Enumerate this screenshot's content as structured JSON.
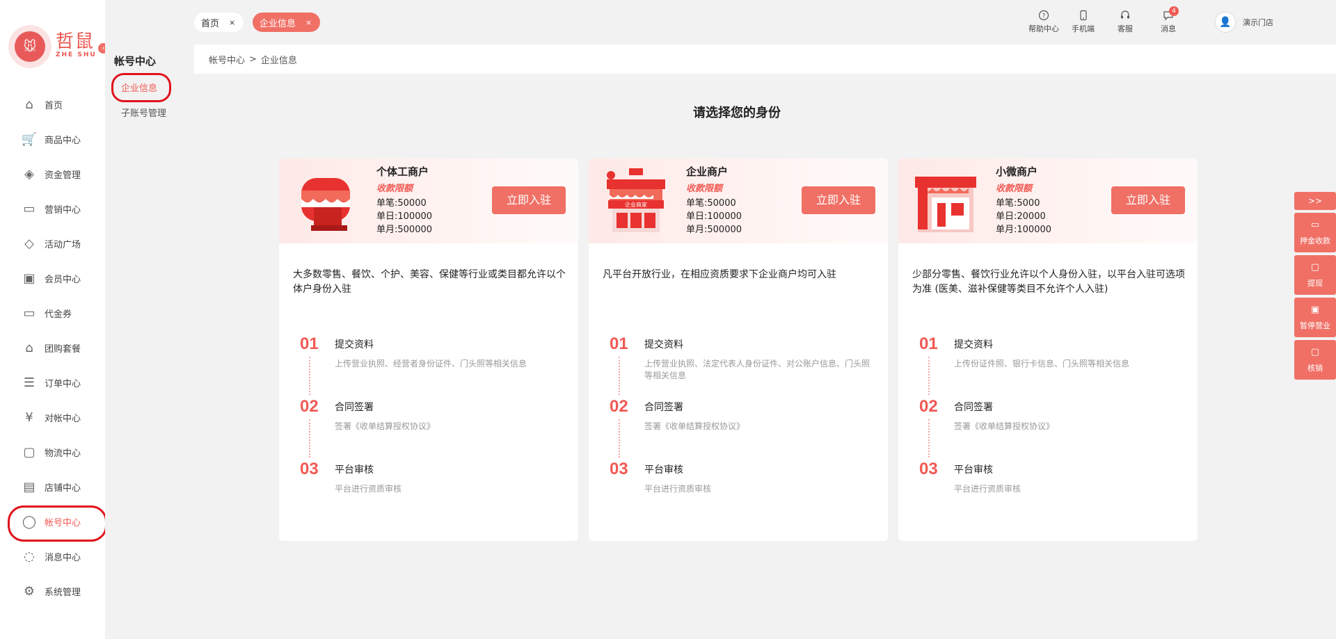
{
  "logo": {
    "cn": "哲鼠",
    "en": "ZHE SHU"
  },
  "collapse_label": "‹",
  "nav": [
    {
      "label": "首页",
      "icon": "home-icon",
      "glyph": "⌂"
    },
    {
      "label": "商品中心",
      "icon": "cart-icon",
      "glyph": "🛒"
    },
    {
      "label": "资金管理",
      "icon": "layers-icon",
      "glyph": "◈"
    },
    {
      "label": "营销中心",
      "icon": "megaphone-icon",
      "glyph": "▭"
    },
    {
      "label": "活动广场",
      "icon": "box-icon",
      "glyph": "◇"
    },
    {
      "label": "会员中心",
      "icon": "vip-card-icon",
      "glyph": "▣"
    },
    {
      "label": "代金券",
      "icon": "coupon-icon",
      "glyph": "▭"
    },
    {
      "label": "团购套餐",
      "icon": "tag-icon",
      "glyph": "⌂"
    },
    {
      "label": "订单中心",
      "icon": "order-icon",
      "glyph": "☰"
    },
    {
      "label": "对帐中心",
      "icon": "yuan-icon",
      "glyph": "¥"
    },
    {
      "label": "物流中心",
      "icon": "package-icon",
      "glyph": "▢"
    },
    {
      "label": "店铺中心",
      "icon": "store-icon",
      "glyph": "▤"
    },
    {
      "label": "帐号中心",
      "icon": "user-icon",
      "glyph": "◯"
    },
    {
      "label": "消息中心",
      "icon": "message-icon",
      "glyph": "◌"
    },
    {
      "label": "系统管理",
      "icon": "settings-icon",
      "glyph": "⚙"
    }
  ],
  "subsidebar": {
    "title": "帐号中心",
    "items": [
      "企业信息",
      "子账号管理"
    ]
  },
  "tabs": {
    "home": "首页",
    "current": "企业信息",
    "close": "×"
  },
  "toolbar": {
    "help": "帮助中心",
    "mobile": "手机端",
    "service": "客服",
    "messages": "消息",
    "message_badge": "4",
    "store_name": "演示门店"
  },
  "breadcrumb": {
    "parent": "帐号中心",
    "sep": ">",
    "current": "企业信息"
  },
  "main": {
    "title": "请选择您的身份",
    "limit_label": "收款限额",
    "join_label": "立即入驻"
  },
  "cards": [
    {
      "name": "个体工商户",
      "lines": [
        "单笔:50000",
        "单日:100000",
        "单月:500000"
      ],
      "desc": "大多数零售、餐饮、个护、美容、保健等行业或类目都允许以个体户身份入驻",
      "steps": [
        {
          "num": "01",
          "title": "提交资料",
          "desc": "上传营业执照、经营者身份证件、门头照等相关信息"
        },
        {
          "num": "02",
          "title": "合同签署",
          "desc": "签署《收单结算授权协议》"
        },
        {
          "num": "03",
          "title": "平台审核",
          "desc": "平台进行资质审核"
        }
      ]
    },
    {
      "name": "企业商户",
      "lines": [
        "单笔:50000",
        "单日:100000",
        "单月:500000"
      ],
      "desc": "凡平台开放行业，在相应资质要求下企业商户均可入驻",
      "steps": [
        {
          "num": "01",
          "title": "提交资料",
          "desc": "上传营业执照、法定代表人身份证件、对公账户信息、门头照等相关信息"
        },
        {
          "num": "02",
          "title": "合同签署",
          "desc": "签署《收单结算授权协议》"
        },
        {
          "num": "03",
          "title": "平台审核",
          "desc": "平台进行资质审核"
        }
      ]
    },
    {
      "name": "小微商户",
      "lines": [
        "单笔:5000",
        "单日:20000",
        "单月:100000"
      ],
      "desc": "少部分零售、餐饮行业允许以个人身份入驻，以平台入驻可选项为准 (医美、滋补保健等类目不允许个人入驻)",
      "steps": [
        {
          "num": "01",
          "title": "提交资料",
          "desc": "上传份证件照、银行卡信息、门头照等相关信息"
        },
        {
          "num": "02",
          "title": "合同签署",
          "desc": "签署《收单结算授权协议》"
        },
        {
          "num": "03",
          "title": "平台审核",
          "desc": "平台进行资质审核"
        }
      ]
    }
  ],
  "floatbar": {
    "toggle": ">>",
    "items": [
      "押金收款",
      "提现",
      "暂停营业",
      "核销"
    ]
  },
  "colors": {
    "accent": "#f07066",
    "highlight": "#e0121c"
  }
}
